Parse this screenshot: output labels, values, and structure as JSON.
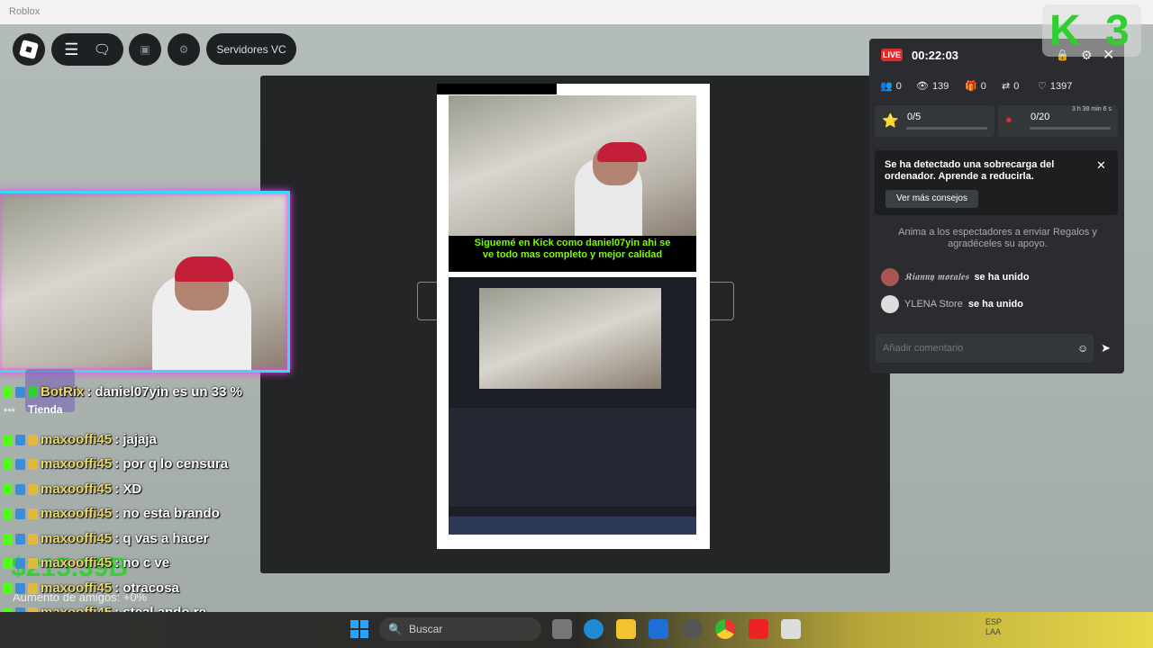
{
  "window": {
    "title": "Roblox"
  },
  "roblox_menu": {
    "servers_label": "Servidores VC",
    "shop_label": "Tienda"
  },
  "preview": {
    "subtitle_line1": "Siguemé en  Kick como daniel07yin ahi se",
    "subtitle_line2": "ve todo mas completo y mejor calidad"
  },
  "live": {
    "badge": "LIVE",
    "time": "00:22:03",
    "stats": {
      "members": "0",
      "viewers": "139",
      "gifts": "0",
      "shares": "0",
      "likes": "1397"
    },
    "goals": [
      {
        "value": "0/5"
      },
      {
        "value": "0/20",
        "timer": "3 h 38 min 6 s"
      }
    ],
    "notice": {
      "text": "Se ha detectado una sobrecarga del ordenador. Aprende a reducirla.",
      "button": "Ver más consejos"
    },
    "gift_hint": "Anima a los espectadores a enviar Regalos y agradéceles su apoyo.",
    "joins": [
      {
        "user": "𝕶𝖎𝖆𝖓𝖓𝖞 𝖒𝖔𝖗𝖆𝖑𝖊𝖘",
        "action": "se ha unido"
      },
      {
        "user": "YLENA Store",
        "action": "se ha unido"
      }
    ],
    "comment_placeholder": "Añadir comentario"
  },
  "chat": [
    {
      "user": "BotRix",
      "msg": ": daniel07yin es un 33 %"
    },
    {
      "user": "maxooffi45",
      "msg": ": jajaja"
    },
    {
      "user": "maxooffi45",
      "msg": ": por q lo censura"
    },
    {
      "user": "maxooffi45",
      "msg": ": XD"
    },
    {
      "user": "maxooffi45",
      "msg": ": no esta brando"
    },
    {
      "user": "maxooffi45",
      "msg": ": q vas a hacer"
    },
    {
      "user": "maxooffi45",
      "msg": ": no c ve"
    },
    {
      "user": "maxooffi45",
      "msg": ": otracosa"
    },
    {
      "user": "maxooffi45",
      "msg": ": steal ando re"
    }
  ],
  "chat_wrap": "enojado",
  "overlay": {
    "money": "$215.39B",
    "friends_boost": "Aumento de amigos: +0%",
    "stars": "***"
  },
  "taskbar": {
    "search_placeholder": "Buscar",
    "lang1": "ESP",
    "lang2": "LAA"
  },
  "colors": {
    "kick_green": "#53fc18",
    "live_red": "#e02b2b"
  }
}
